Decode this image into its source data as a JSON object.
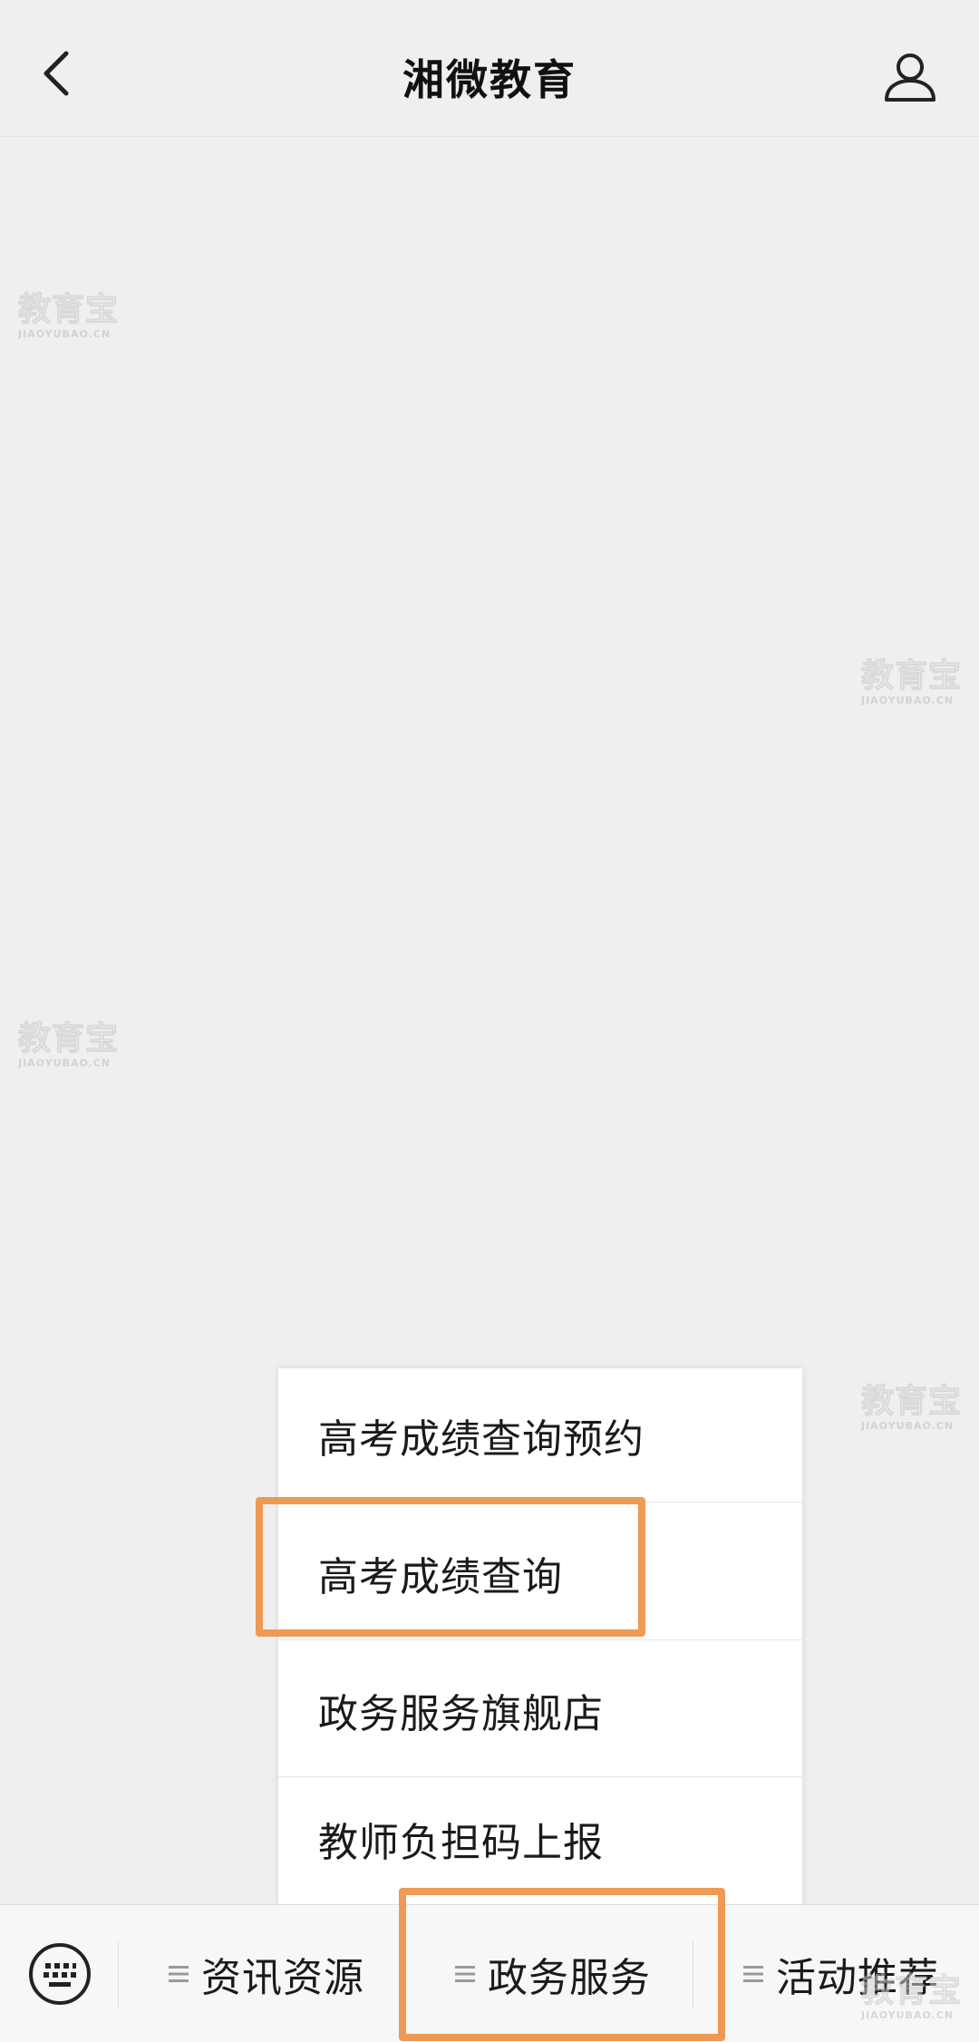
{
  "header": {
    "title": "湘微教育"
  },
  "watermark": {
    "main": "教育宝",
    "sub": "JIAOYUBAO.CN"
  },
  "menu": {
    "items": [
      {
        "label": "高考成绩查询预约"
      },
      {
        "label": "高考成绩查询"
      },
      {
        "label": "政务服务旗舰店"
      },
      {
        "label": "教师负担码上报"
      }
    ]
  },
  "bottom_bar": {
    "tabs": [
      {
        "label": "资讯资源"
      },
      {
        "label": "政务服务"
      },
      {
        "label": "活动推荐"
      }
    ]
  },
  "colors": {
    "highlight": "#ee9a54",
    "background": "#efefef"
  },
  "icons": {
    "back": "chevron-left-icon",
    "profile": "user-icon",
    "keyboard": "keyboard-icon",
    "menu": "hamburger-icon"
  }
}
